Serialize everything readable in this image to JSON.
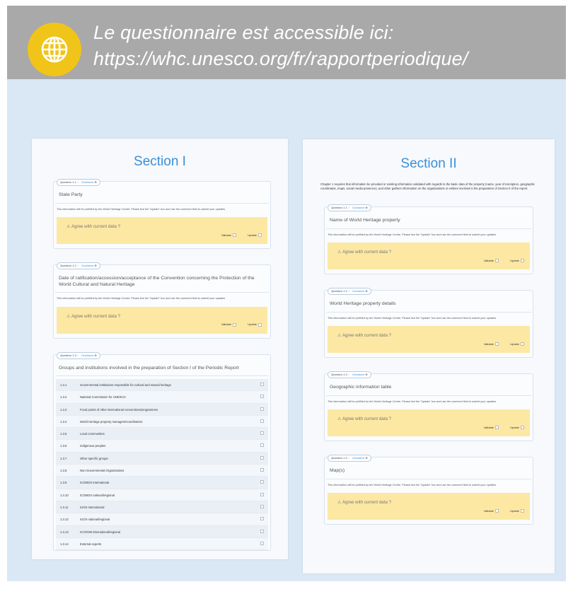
{
  "banner": {
    "line1": "Le questionnaire est accessible ici:",
    "line2": "https://whc.unesco.org/fr/rapportperiodique/",
    "icon": "globe-icon",
    "icon_color": "#f0c419",
    "background": "#a9a9a9"
  },
  "common": {
    "guidance": "Guidance",
    "info": "This information will be prefilled by the World Heritage Centre. Please tick the \"Update\" box and use the comment field to submit your updates",
    "agree": "Agree with current data ?",
    "validate": "Validate",
    "update": "Update"
  },
  "section1": {
    "title": "Section I",
    "q1": {
      "tag": "Question 1.1",
      "title": "State Party"
    },
    "q2": {
      "tag": "Question 1.2",
      "title": "Date of ratification/accession/acceptance of the Convention concerning the Protection of the World Cultural and Natural Heritage"
    },
    "q3": {
      "tag": "Question 1.3",
      "title": "Groups and institutions involved in the preparation of Section I of the Periodic Report",
      "rows": [
        {
          "num": "1.3.1",
          "label": "Governmental institutions responsible for cultural and natural heritage"
        },
        {
          "num": "1.3.2",
          "label": "National Commission for UNESCO"
        },
        {
          "num": "1.3.3",
          "label": "Focal points of other international conventions/programmes"
        },
        {
          "num": "1.3.4",
          "label": "World Heritage property managers/coordinators"
        },
        {
          "num": "1.3.5",
          "label": "Local communities"
        },
        {
          "num": "1.3.6",
          "label": "Indigenous peoples"
        },
        {
          "num": "1.3.7",
          "label": "Other specific groups"
        },
        {
          "num": "1.3.8",
          "label": "Non-Governmental Organizations"
        },
        {
          "num": "1.3.9",
          "label": "ICOMOS International"
        },
        {
          "num": "1.3.10",
          "label": "ICOMOS national/regional"
        },
        {
          "num": "1.3.11",
          "label": "IUCN International"
        },
        {
          "num": "1.3.12",
          "label": "IUCN national/regional"
        },
        {
          "num": "1.3.13",
          "label": "ICCROM international/regional"
        },
        {
          "num": "1.3.14",
          "label": "External experts"
        }
      ]
    }
  },
  "section2": {
    "title": "Section II",
    "intro": "Chapter 1 requires that information be provided or existing information validated with regards to the basic data of the property (name, year of inscription, geographic coordinates, maps, social media presence), and other gathers information on the organisations or entities involved in the preparation of Section II of the report.",
    "q1": {
      "tag": "Question 1.1",
      "title": "Name of World Heritage property"
    },
    "q2": {
      "tag": "Question 1.2",
      "title": "World Heritage property details"
    },
    "q3": {
      "tag": "Question 1.3",
      "title": "Geographic information table"
    },
    "q4": {
      "tag": "Question 1.4",
      "title": "Map(s)"
    }
  }
}
